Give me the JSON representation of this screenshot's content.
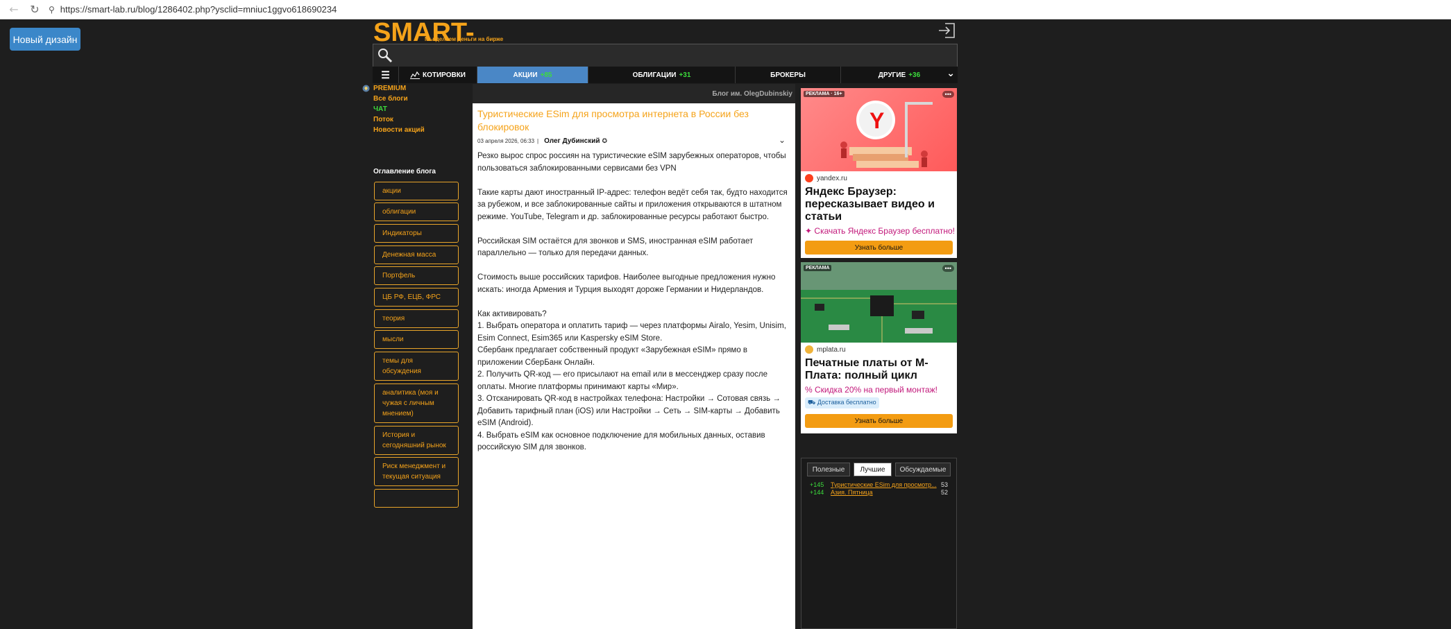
{
  "browser": {
    "url": "https://smart-lab.ru/blog/1286402.php?ysclid=mniuc1ggvo618690234"
  },
  "header": {
    "new_design_label": "Новый дизайн",
    "logo": "SMART-LAB",
    "tagline": "Мы делаем деньги на бирже"
  },
  "nav": {
    "quotes": "КОТИРОВКИ",
    "stocks": "АКЦИИ",
    "stocks_count": "+85",
    "bonds": "ОБЛИГАЦИИ",
    "bonds_count": "+31",
    "brokers": "БРОКЕРЫ",
    "other": "ДРУГИЕ",
    "other_count": "+36"
  },
  "sidebar": {
    "links": [
      "PREMIUM",
      "Все блоги",
      "ЧАТ",
      "Поток",
      "Новости акций"
    ],
    "toc_title": "Оглавление блога",
    "toc": [
      "акции",
      "облигации",
      "Индикаторы",
      "Денежная масса",
      "Портфель",
      "ЦБ РФ, ЕЦБ, ФРС",
      "теория",
      "мысли",
      "темы для обсуждения",
      "аналитика (моя и чужая с личным мнением)",
      "История и сегодняшний рынок",
      "Риск менеджмент и текущая ситуация"
    ]
  },
  "article": {
    "blog_label": "Блог им. OlegDubinskiy",
    "title": "Туристические ESim для просмотра интернета в России без блокировок",
    "date": "03 апреля 2026, 06:33",
    "author": "Олег Дубинский",
    "paragraphs": [
      "Резко вырос спрос россиян на туристические eSIM зарубежных операторов, чтобы пользоваться заблокированными сервисами без VPN",
      "Такие карты дают иностранный IP-адрес: телефон ведёт себя так, будто находится за рубежом, и все заблокированные сайты и приложения открываются в штатном режиме. YouTube, Telegram и др. заблокированные ресурсы работают быстро.",
      "Российская SIM остаётся для звонков и SMS, иностранная eSIM работает параллельно — только для передачи данных.",
      "Стоимость выше российских тарифов. Наиболее выгодные предложения нужно искать: иногда Армения и Турция выходят дороже Германии и Нидерландов.",
      "Как активировать?",
      "1. Выбрать оператора и оплатить тариф — через платформы Airalo, Yesim, Unisim, Esim Connect, Esim365 или Kaspersky eSIM Store.",
      "Сбербанк предлагает собственный продукт «Зарубежная eSIM» прямо в приложении СберБанк Онлайн.",
      "2. Получить QR-код — его присылают на email или в мессенджер сразу после оплаты. Многие платформы принимают карты «Мир».",
      "3. Отсканировать QR-код в настройках телефона: Настройки → Сотовая связь → Добавить тарифный план (iOS) или Настройки → Сеть → SIM-карты → Добавить eSIM (Android).",
      "4. Выбрать eSIM как основное подключение для мобильных данных, оставив российскую SIM для звонков."
    ]
  },
  "ads": [
    {
      "tag": "РЕКЛАМА · 16+",
      "domain": "yandex.ru",
      "title": "Яндекс Браузер: пересказывает видео и статьи",
      "cta_text": "Скачать Яндекс Браузер бесплатно!",
      "button": "Узнать больше",
      "dots": "•••"
    },
    {
      "tag": "РЕКЛАМА",
      "domain": "mplata.ru",
      "title": "Печатные платы от М-Плата: полный цикл",
      "cta_text": "Скидка 20% на первый монтаж!",
      "badge": "Доставка бесплатно",
      "button": "Узнать больше",
      "dots": "•••"
    }
  ],
  "tabs": {
    "items": [
      "Полезные",
      "Лучшие",
      "Обсуждаемые"
    ],
    "active": "Лучшие",
    "rows": [
      {
        "score": "+145",
        "title": "Туристические ESim для просмотр...",
        "count": "53"
      },
      {
        "score": "+144",
        "title": "Азия. Пятница",
        "count": "52"
      }
    ]
  },
  "colors": {
    "accent": "#f5a31a",
    "nav_active": "#4a87c6",
    "green": "#3cdc3c",
    "ad_button": "#f39c12"
  }
}
